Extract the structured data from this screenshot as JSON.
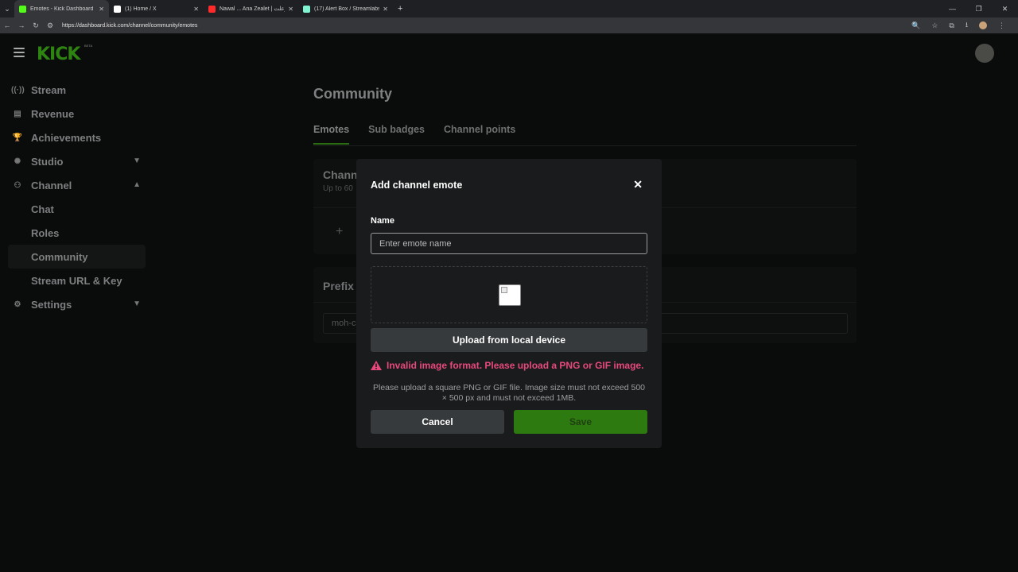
{
  "browser": {
    "tabs": [
      {
        "title": "Emotes - Kick Dashboard",
        "favicon_color": "#53fc18",
        "active": true
      },
      {
        "title": "(1) Home / X",
        "favicon_color": "#ffffff",
        "active": false
      },
      {
        "title": "Nawal ... Ana Zealet | انا زعلت ...",
        "favicon_color": "#ff2b2b",
        "active": false
      },
      {
        "title": "(17) Alert Box / Streamlabs",
        "favicon_color": "#80f5d2",
        "active": false
      }
    ],
    "url": "https://dashboard.kick.com/channel/community/emotes"
  },
  "header": {
    "logo": "KICK",
    "beta": "BETA"
  },
  "sidebar": {
    "items": [
      {
        "label": "Stream",
        "icon": "broadcast-icon"
      },
      {
        "label": "Revenue",
        "icon": "chart-icon"
      },
      {
        "label": "Achievements",
        "icon": "trophy-icon"
      },
      {
        "label": "Studio",
        "icon": "studio-icon",
        "expand": "collapsed"
      },
      {
        "label": "Channel",
        "icon": "channel-icon",
        "expand": "expanded"
      },
      {
        "label": "Chat",
        "sub": true
      },
      {
        "label": "Roles",
        "sub": true
      },
      {
        "label": "Community",
        "sub": true,
        "active": true
      },
      {
        "label": "Stream URL & Key",
        "sub": true
      },
      {
        "label": "Settings",
        "icon": "gear-icon",
        "expand": "collapsed"
      }
    ]
  },
  "main": {
    "title": "Community",
    "tabs": [
      "Emotes",
      "Sub badges",
      "Channel points"
    ],
    "active_tab": "Emotes",
    "card1": {
      "heading": "Chann",
      "sub": "Up to 60"
    },
    "card2": {
      "heading": "Prefix",
      "input_value": "moh-c"
    }
  },
  "modal": {
    "title": "Add channel emote",
    "name_label": "Name",
    "name_placeholder": "Enter emote name",
    "upload_label": "Upload from local device",
    "error": "Invalid image format. Please upload a PNG or GIF image.",
    "help": "Please upload a square PNG or GIF file. Image size must not exceed 500 × 500 px and must not exceed 1MB.",
    "cancel_label": "Cancel",
    "save_label": "Save"
  }
}
